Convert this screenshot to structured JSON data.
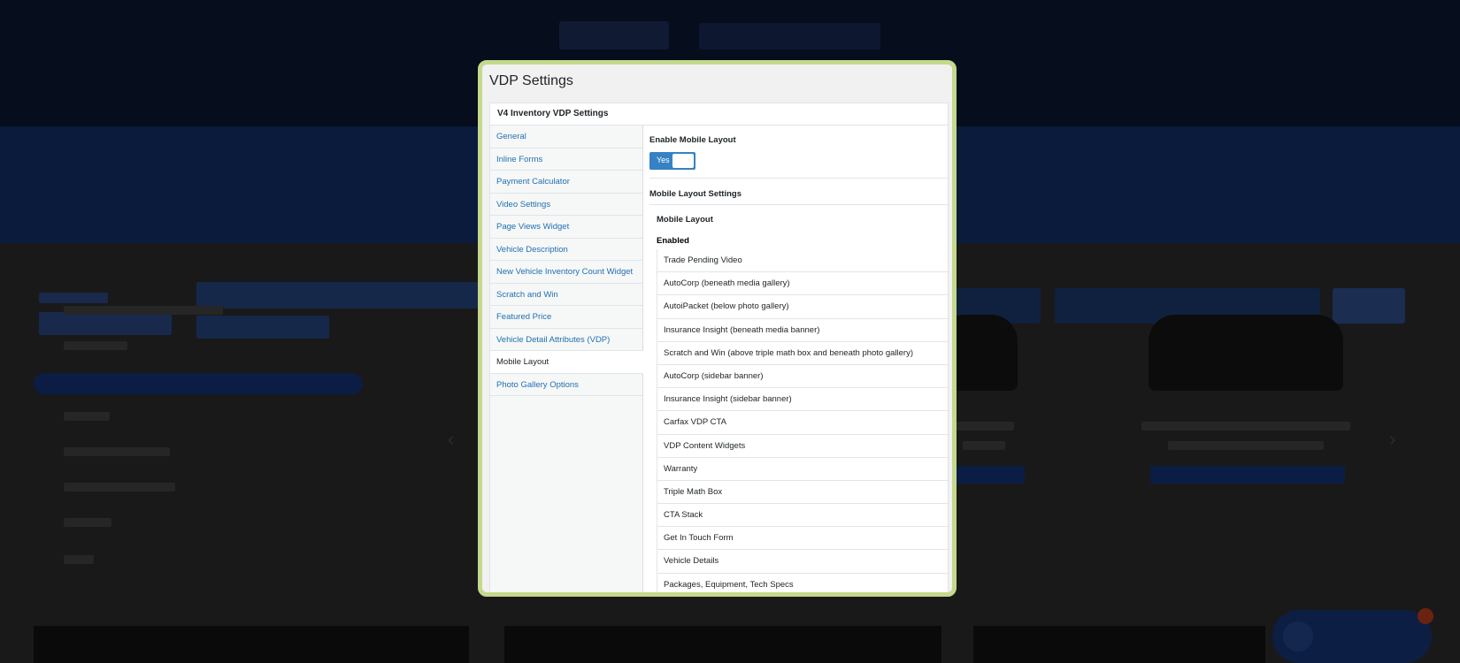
{
  "modal": {
    "title": "VDP Settings",
    "panel_title": "V4 Inventory VDP Settings"
  },
  "sidebar": {
    "items": [
      {
        "label": "General"
      },
      {
        "label": "Inline Forms"
      },
      {
        "label": "Payment Calculator"
      },
      {
        "label": "Video Settings"
      },
      {
        "label": "Page Views Widget"
      },
      {
        "label": "Vehicle Description"
      },
      {
        "label": "New Vehicle Inventory Count Widget"
      },
      {
        "label": "Scratch and Win"
      },
      {
        "label": "Featured Price"
      },
      {
        "label": "Vehicle Detail Attributes (VDP)"
      },
      {
        "label": "Mobile Layout",
        "active": true
      },
      {
        "label": "Photo Gallery Options"
      }
    ]
  },
  "content": {
    "enable_label": "Enable Mobile Layout",
    "toggle_text": "Yes",
    "settings_heading": "Mobile Layout Settings",
    "mobile_layout_label": "Mobile Layout",
    "enabled_label": "Enabled",
    "enabled_items": [
      "Trade Pending Video",
      "AutoCorp (beneath media gallery)",
      "AutoiPacket (below photo gallery)",
      "Insurance Insight (beneath media banner)",
      "Scratch and Win (above triple math box and beneath photo gallery)",
      "AutoCorp (sidebar banner)",
      "Insurance Insight (sidebar banner)",
      "Carfax VDP CTA",
      "VDP Content Widgets",
      "Warranty",
      "Triple Math Box",
      "CTA Stack",
      "Get In Touch Form",
      "Vehicle Details",
      "Packages, Equipment, Tech Specs"
    ]
  },
  "colors": {
    "link": "#2271b1",
    "toggle": "#3582c4",
    "modal_border": "#c4d98c"
  }
}
